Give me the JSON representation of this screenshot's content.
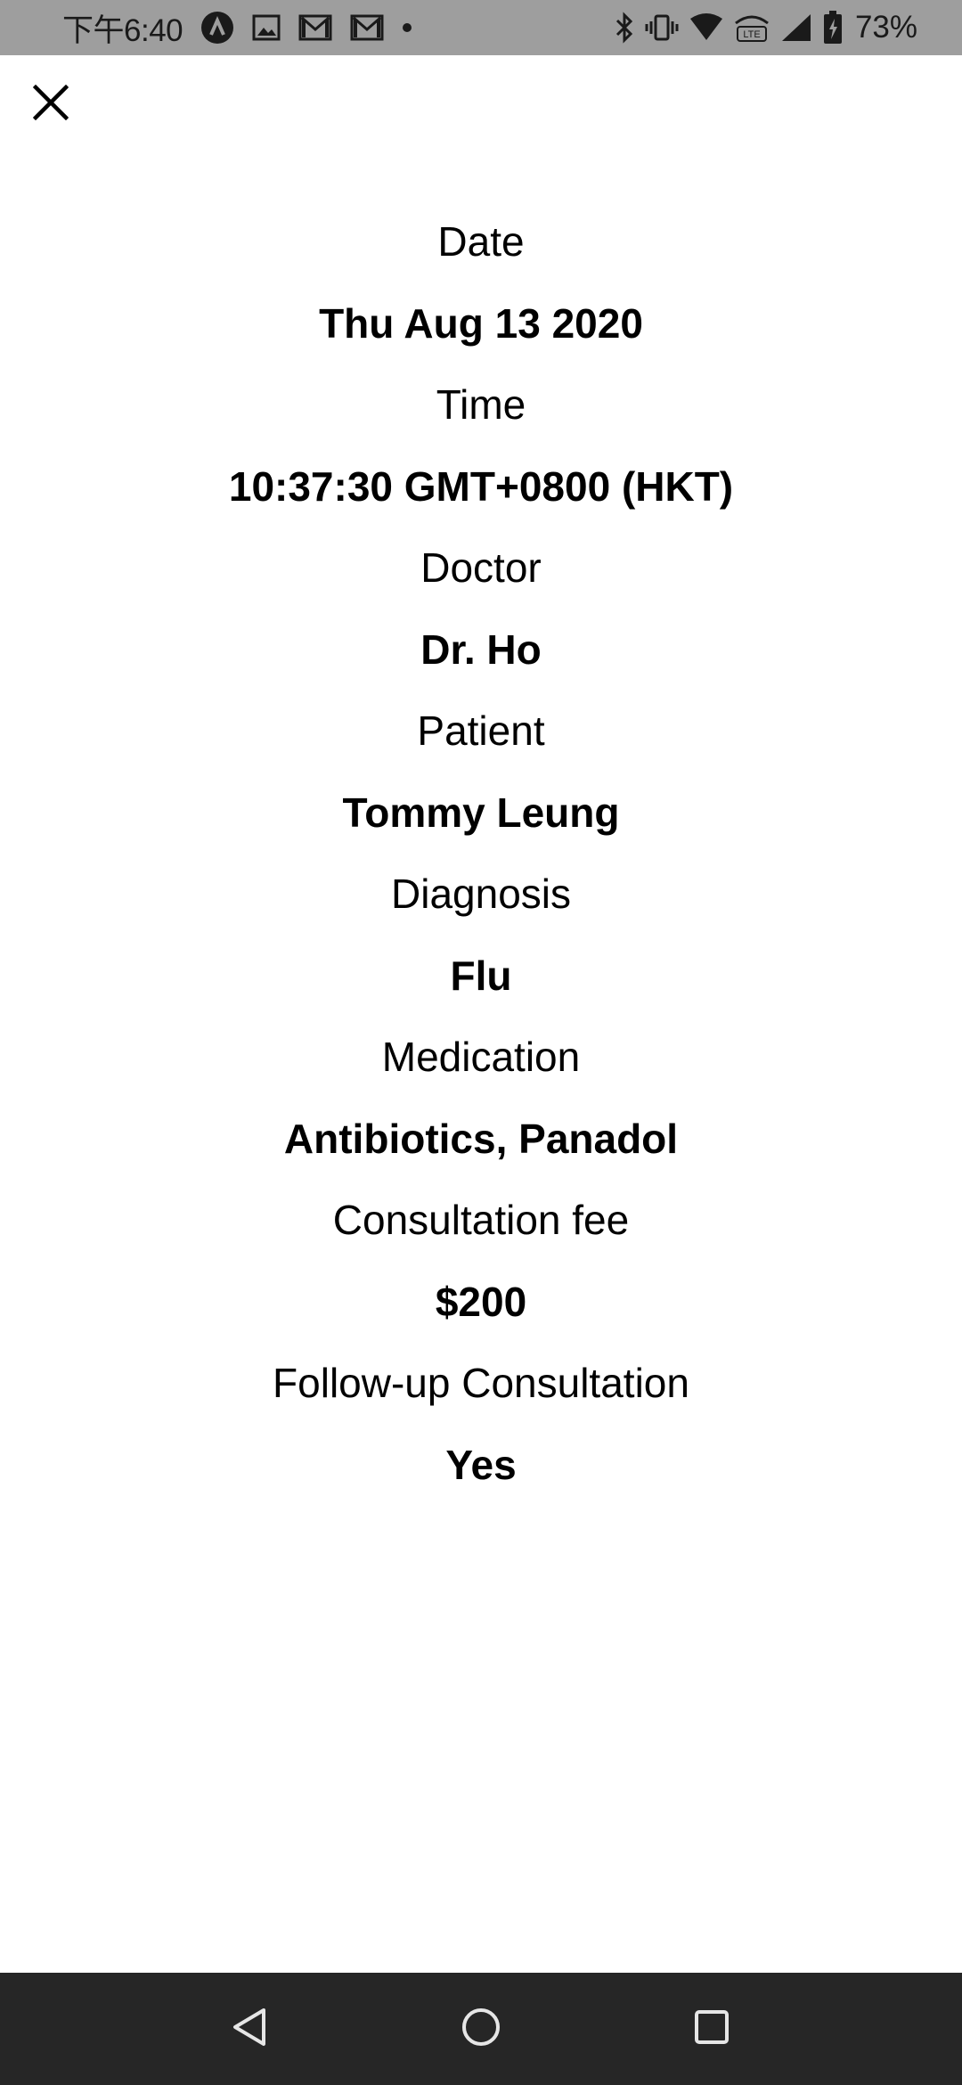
{
  "status_bar": {
    "time": "下午6:40",
    "battery_percent": "73%",
    "left_icons": [
      "avast-icon",
      "gallery-icon",
      "gmail-icon",
      "gmail-icon",
      "dot-icon"
    ],
    "right_icons": [
      "bluetooth-icon",
      "vibrate-icon",
      "wifi-icon",
      "volte-icon",
      "signal-icon",
      "battery-charging-icon"
    ]
  },
  "close_icon": "close-icon",
  "details": [
    {
      "label": "Date",
      "value": "Thu Aug 13 2020"
    },
    {
      "label": "Time",
      "value": "10:37:30 GMT+0800 (HKT)"
    },
    {
      "label": "Doctor",
      "value": "Dr. Ho"
    },
    {
      "label": "Patient",
      "value": "Tommy Leung"
    },
    {
      "label": "Diagnosis",
      "value": "Flu"
    },
    {
      "label": "Medication",
      "value": "Antibiotics, Panadol"
    },
    {
      "label": "Consultation fee",
      "value": "$200"
    },
    {
      "label": "Follow-up Consultation",
      "value": "Yes"
    }
  ],
  "nav_bar": {
    "icons": [
      "back-icon",
      "home-icon",
      "recents-icon"
    ]
  },
  "colors": {
    "status_bar_bg": "#9e9e9e",
    "nav_bar_bg": "#262626",
    "text": "#000000"
  }
}
